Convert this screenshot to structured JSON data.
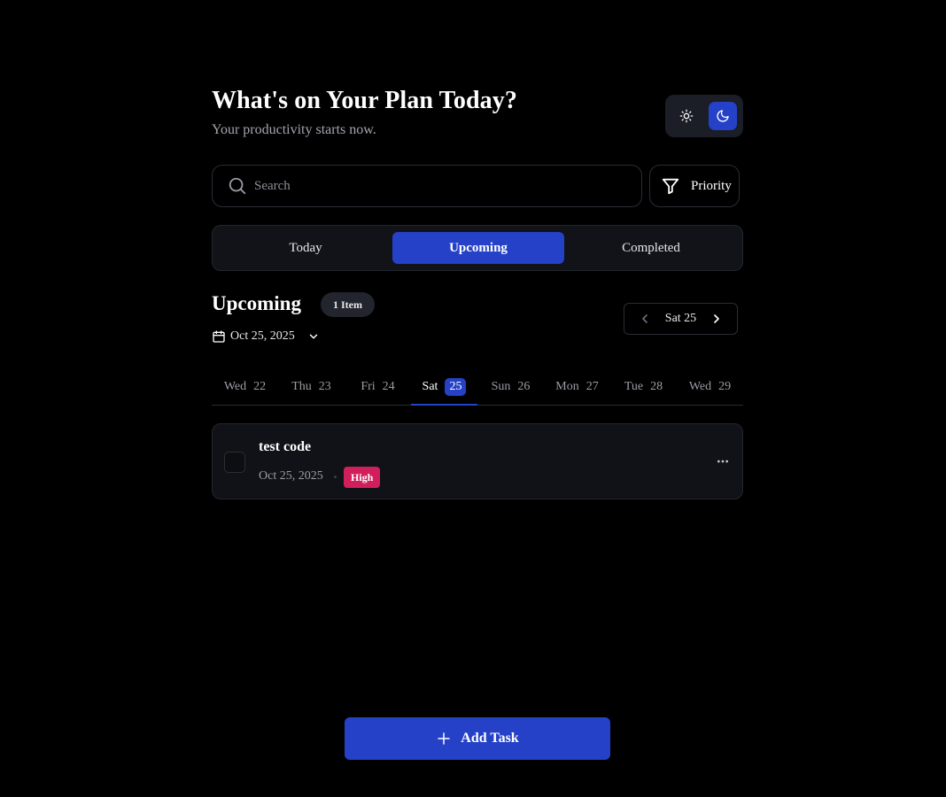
{
  "header": {
    "title": "What's on Your Plan Today?",
    "subtitle": "Your productivity starts now."
  },
  "theme_toggle": {
    "light_icon": "sun-icon",
    "dark_icon": "moon-icon",
    "selected": "dark"
  },
  "search": {
    "placeholder": "Search",
    "value": "",
    "icon": "search-icon"
  },
  "filter": {
    "label": "Priority",
    "icon": "filter-icon"
  },
  "tabs": [
    {
      "label": "Today",
      "active": false
    },
    {
      "label": "Upcoming",
      "active": true
    },
    {
      "label": "Completed",
      "active": false
    }
  ],
  "section": {
    "title": "Upcoming",
    "count_badge": "1 Item",
    "selected_date": "Oct 25, 2025"
  },
  "day_nav": {
    "current": "Sat 25"
  },
  "week": [
    {
      "day": "Wed",
      "num": "22",
      "active": false
    },
    {
      "day": "Thu",
      "num": "23",
      "active": false
    },
    {
      "day": "Fri",
      "num": "24",
      "active": false
    },
    {
      "day": "Sat",
      "num": "25",
      "active": true
    },
    {
      "day": "Sun",
      "num": "26",
      "active": false
    },
    {
      "day": "Mon",
      "num": "27",
      "active": false
    },
    {
      "day": "Tue",
      "num": "28",
      "active": false
    },
    {
      "day": "Wed",
      "num": "29",
      "active": false
    }
  ],
  "tasks": [
    {
      "title": "test code",
      "date": "Oct 25, 2025",
      "priority": "High",
      "completed": false
    }
  ],
  "add_button": {
    "label": "Add Task"
  },
  "colors": {
    "background": "#000000",
    "accent": "#2541c8",
    "priority_high": "#d11f5c"
  }
}
